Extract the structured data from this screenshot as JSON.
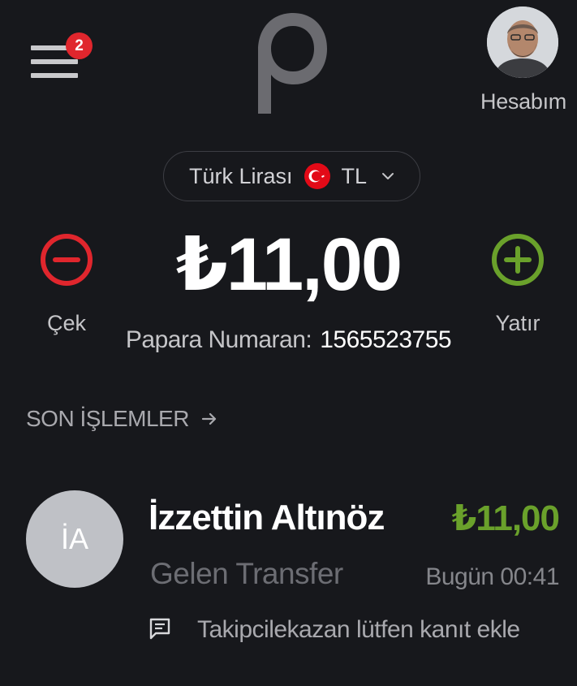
{
  "header": {
    "menu_badge": "2",
    "account_label": "Hesabım"
  },
  "currency": {
    "name": "Türk Lirası",
    "code": "TL",
    "flag": "turkey-flag-icon"
  },
  "balance": {
    "amount": "₺11,00",
    "withdraw_label": "Çek",
    "deposit_label": "Yatır",
    "papara_number_label": "Papara Numaran:",
    "papara_number": "1565523755"
  },
  "recent": {
    "title": "SON İŞLEMLER",
    "transactions": [
      {
        "initials": "İA",
        "name": "İzzettin Altınöz",
        "amount": "₺11,00",
        "type": "Gelen Transfer",
        "time": "Bugün 00:41",
        "note": "Takipcilekazan lütfen kanıt ekle",
        "note_icon": "message-icon"
      }
    ]
  },
  "colors": {
    "background": "#17181c",
    "withdraw": "#e0262d",
    "deposit": "#6aa12b",
    "badge": "#e0262d"
  }
}
